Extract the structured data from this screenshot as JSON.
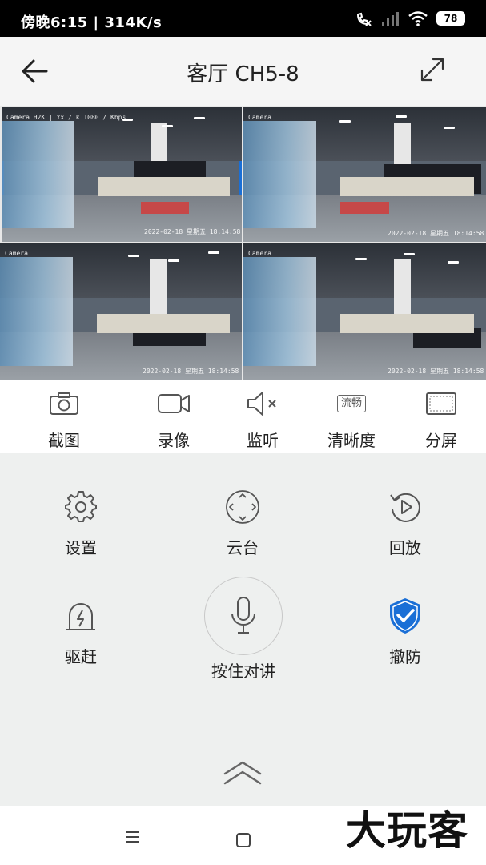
{
  "status_bar": {
    "time_speed": "傍晚6:15 | 314K/s",
    "battery": "78"
  },
  "header": {
    "title": "客厅 CH5-8"
  },
  "video_grid": {
    "tiles": [
      {
        "osd_top": "Camera H2K  |  Yx / k  1080  / Kbps",
        "osd_bottom": "2022-02-18  星期五  18:14:58",
        "selected": true
      },
      {
        "osd_top": "Camera",
        "osd_bottom": "2022-02-18  星期五  18:14:58",
        "selected": false
      },
      {
        "osd_top": "Camera",
        "osd_bottom": "2022-02-18  星期五  18:14:58",
        "selected": false
      },
      {
        "osd_top": "Camera",
        "osd_bottom": "2022-02-18  星期五  18:14:58",
        "selected": false
      }
    ]
  },
  "toolbar": {
    "screenshot": "截图",
    "record": "录像",
    "listen": "监听",
    "quality_badge": "流畅",
    "quality": "清晰度",
    "split": "分屏"
  },
  "controls": {
    "settings": "设置",
    "ptz": "云台",
    "playback": "回放",
    "deter": "驱赶",
    "talk": "按住对讲",
    "disarm": "撤防"
  },
  "watermark": "大玩客",
  "colors": {
    "accent": "#1a6fd6",
    "panel_bg": "#eef0ef",
    "icon_gray": "#555555"
  }
}
